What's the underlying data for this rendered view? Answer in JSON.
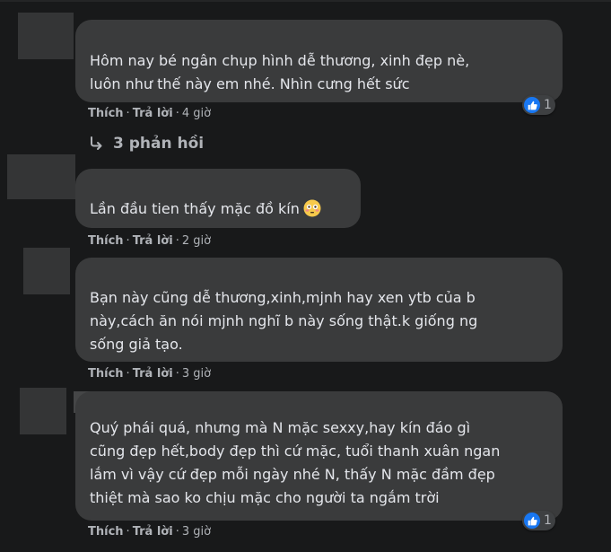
{
  "comments": [
    {
      "text_lines": [
        "Hôm nay bé ngân chụp hình dễ thương, xinh đẹp nè,",
        "luôn như thế này em nhé. Nhìn cưng hết sức"
      ],
      "like": "Thích",
      "reply": "Trả lời",
      "time": "4 giờ",
      "reaction_count": "1"
    },
    {
      "text_lines": [
        "Lần đầu tien thấy mặc đồ kín"
      ],
      "emoji_icon": "flushed-face-emoji",
      "like": "Thích",
      "reply": "Trả lời",
      "time": "2 giờ"
    },
    {
      "text_lines": [
        "Bạn này cũng dễ thương,xinh,mjnh hay xen ytb của b",
        "này,cách ăn nói mjnh nghĩ b này sống thật.k giống ng",
        "sống giả tạo."
      ],
      "like": "Thích",
      "reply": "Trả lời",
      "time": "3 giờ"
    },
    {
      "text_lines": [
        "Quý phái quá, nhưng mà N mặc sexxy,hay kín đáo gì",
        "cũng đẹp hết,body đẹp thì cứ mặc, tuổi thanh xuân ngan",
        "lắm vì vậy cứ đẹp mỗi ngày nhé N, thấy N mặc đầm đẹp",
        "thiệt mà sao ko chịu mặc cho người ta ngắm trời"
      ],
      "like": "Thích",
      "reply": "Trả lời",
      "time": "3 giờ",
      "reaction_count": "1"
    }
  ],
  "replies_link": {
    "icon": "reply-arrow-icon",
    "label": "3 phản hồi"
  },
  "colors": {
    "background": "#18191a",
    "bubble": "#3a3b3c",
    "meta_text": "#b0b3b8",
    "like_blue": "#1877f2"
  }
}
